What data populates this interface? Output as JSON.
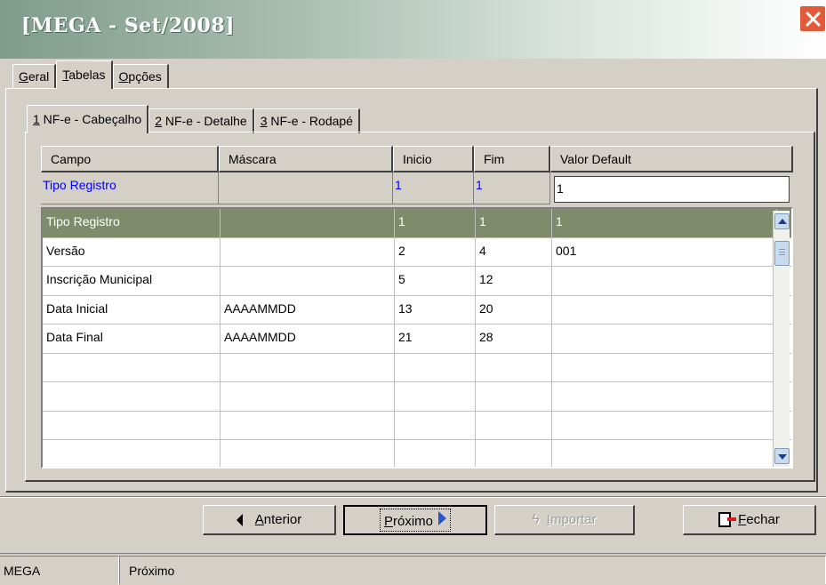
{
  "window": {
    "title": "[MEGA - Set/2008]",
    "close_icon": "close-icon"
  },
  "tabs": [
    {
      "pre": "",
      "u": "G",
      "post": "eral"
    },
    {
      "pre": "",
      "u": "T",
      "post": "abelas"
    },
    {
      "pre": "",
      "u": "O",
      "post": "pções"
    }
  ],
  "subtabs": [
    {
      "u": "1",
      "post": " NF-e - Cabeçalho"
    },
    {
      "u": "2",
      "post": " NF-e - Detalhe"
    },
    {
      "u": "3",
      "post": " NF-e - Rodapé"
    }
  ],
  "grid": {
    "headers": [
      "Campo",
      "Máscara",
      "Inicio",
      "Fim",
      "Valor Default"
    ],
    "filter": [
      "Tipo Registro",
      "",
      "1",
      "1",
      "1"
    ],
    "rows": [
      [
        "Tipo Registro",
        "",
        "1",
        "1",
        "1"
      ],
      [
        "Versão",
        "",
        "2",
        "4",
        "001"
      ],
      [
        "Inscrição Municipal",
        "",
        "5",
        "12",
        ""
      ],
      [
        "Data Inicial",
        "AAAAMMDD",
        "13",
        "20",
        ""
      ],
      [
        "Data Final",
        "AAAAMMDD",
        "21",
        "28",
        ""
      ],
      [
        "",
        "",
        "",
        "",
        ""
      ],
      [
        "",
        "",
        "",
        "",
        ""
      ],
      [
        "",
        "",
        "",
        "",
        ""
      ],
      [
        "",
        "",
        "",
        "",
        ""
      ]
    ],
    "selected_row": 0
  },
  "buttons": {
    "anterior": {
      "u": "A",
      "post": "nterior"
    },
    "proximo": {
      "u": "P",
      "post": "róximo"
    },
    "importar": {
      "u": "I",
      "post": "mportar"
    },
    "fechar": {
      "u": "F",
      "post": "echar"
    }
  },
  "status": {
    "panel1": "MEGA",
    "panel2": "Próximo"
  }
}
